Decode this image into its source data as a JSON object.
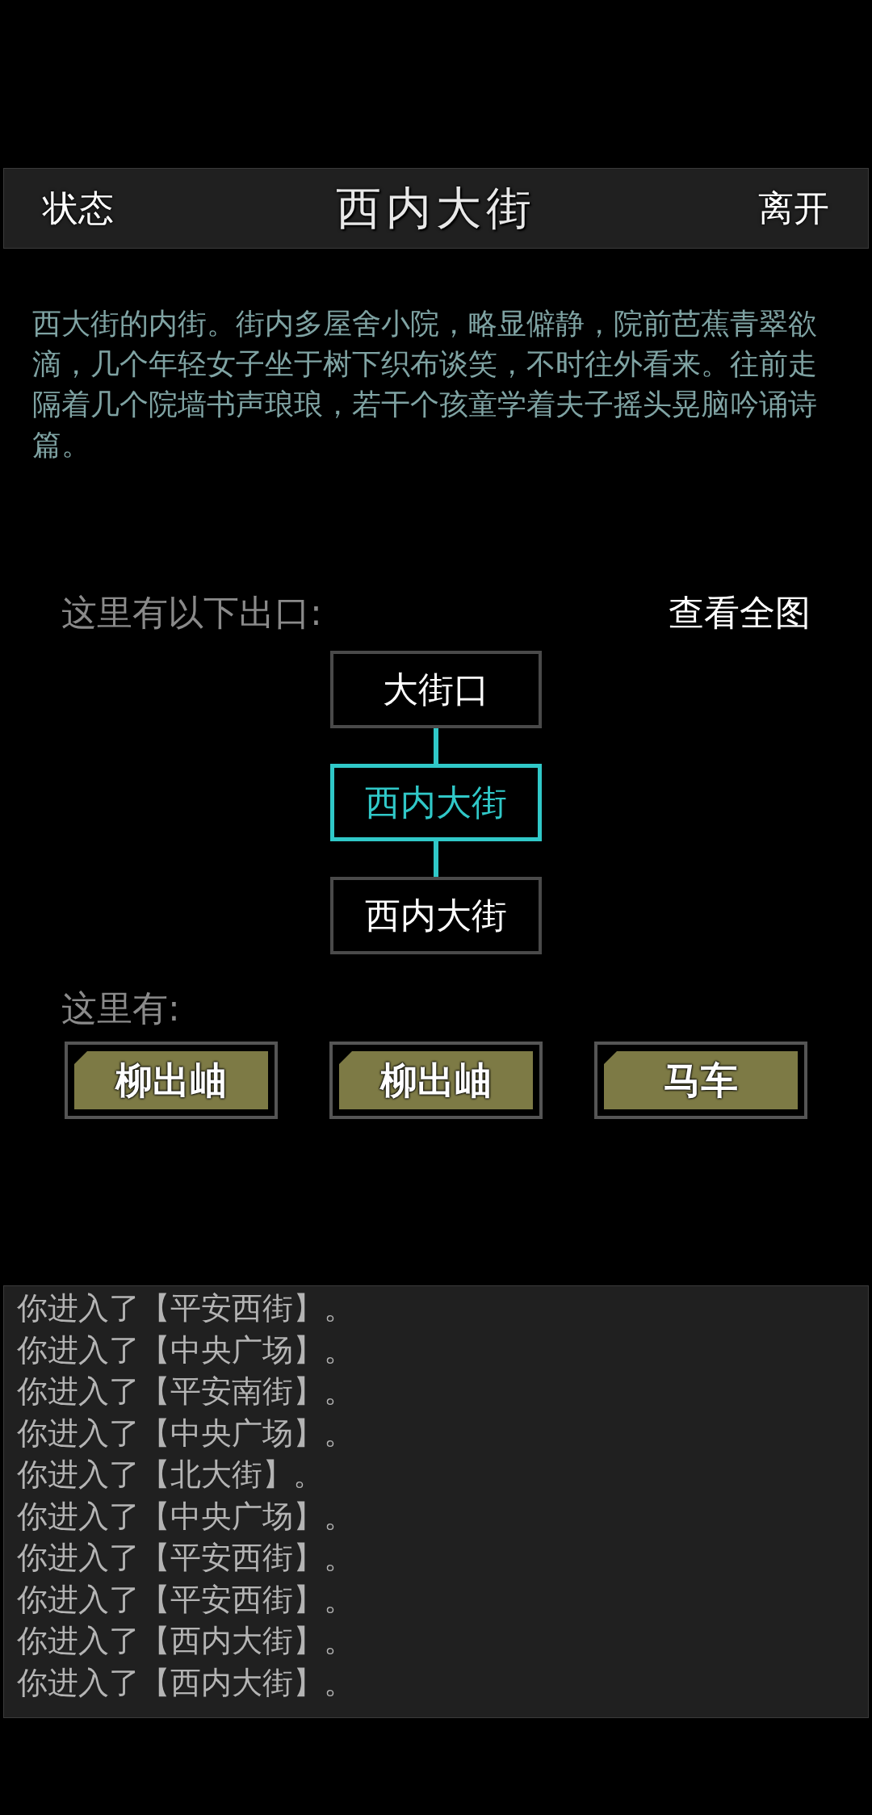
{
  "header": {
    "left_button": "状态",
    "title": "西内大街",
    "right_button": "离开"
  },
  "description": "西大街的内街。街内多屋舍小院，略显僻静，院前芭蕉青翠欲滴，几个年轻女子坐于树下织布谈笑，不时往外看来。往前走隔着几个院墙书声琅琅，若干个孩童学着夫子摇头晃脑吟诵诗篇。",
  "exits": {
    "label": "这里有以下出口:",
    "map_button": "查看全图",
    "nodes": [
      {
        "label": "大街口",
        "selected": false
      },
      {
        "label": "西内大街",
        "selected": true
      },
      {
        "label": "西内大街",
        "selected": false
      }
    ]
  },
  "here": {
    "label": "这里有:",
    "items": [
      "柳出岫",
      "柳出岫",
      "马车"
    ]
  },
  "log": [
    "你进入了【平安西街】。",
    "你进入了【中央广场】。",
    "你进入了【平安南街】。",
    "你进入了【中央广场】。",
    "你进入了【北大街】。",
    "你进入了【中央广场】。",
    "你进入了【平安西街】。",
    "你进入了【平安西街】。",
    "你进入了【西内大街】。",
    "你进入了【西内大街】。"
  ]
}
